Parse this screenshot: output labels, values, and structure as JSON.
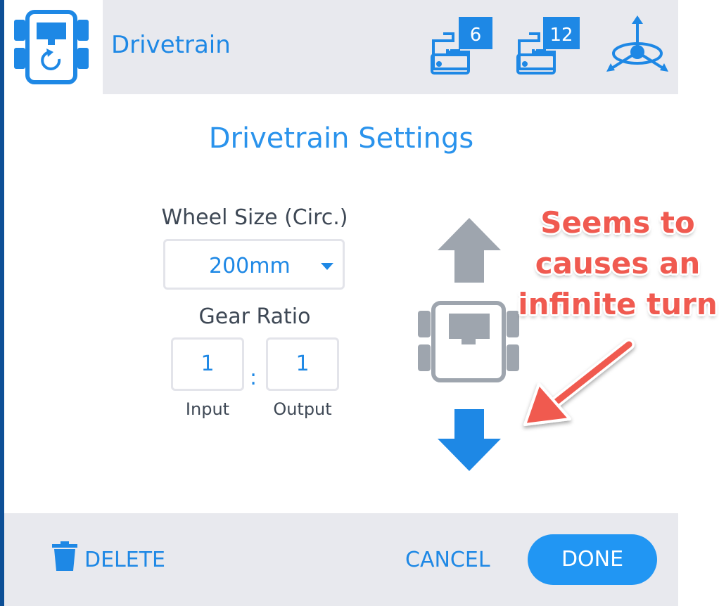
{
  "header": {
    "title": "Drivetrain",
    "badge_left": "6",
    "badge_right": "12"
  },
  "dialog": {
    "title": "Drivetrain Settings",
    "wheel_size_label": "Wheel Size (Circ.)",
    "wheel_size_value": "200mm",
    "gear_ratio_label": "Gear Ratio",
    "input_value": "1",
    "output_value": "1",
    "ratio_separator": ":",
    "input_label": "Input",
    "output_label": "Output"
  },
  "footer": {
    "delete_label": "DELETE",
    "cancel_label": "CANCEL",
    "done_label": "DONE"
  },
  "annotation": {
    "line1": "Seems to",
    "line2": "causes an",
    "line3": "infinite turn"
  },
  "colors": {
    "accent": "#1e88e5",
    "header_bg": "#e8e9ee",
    "robot_gray": "#9ea5ae",
    "annotation_red": "#f05a50",
    "frame_navy": "#0d4f96"
  },
  "icons": [
    "drivetrain-icon",
    "motor-icon",
    "motor-icon",
    "gyro-icon",
    "arrow-up-icon",
    "robot-icon",
    "arrow-down-icon",
    "trash-icon",
    "annotation-arrow-icon"
  ]
}
